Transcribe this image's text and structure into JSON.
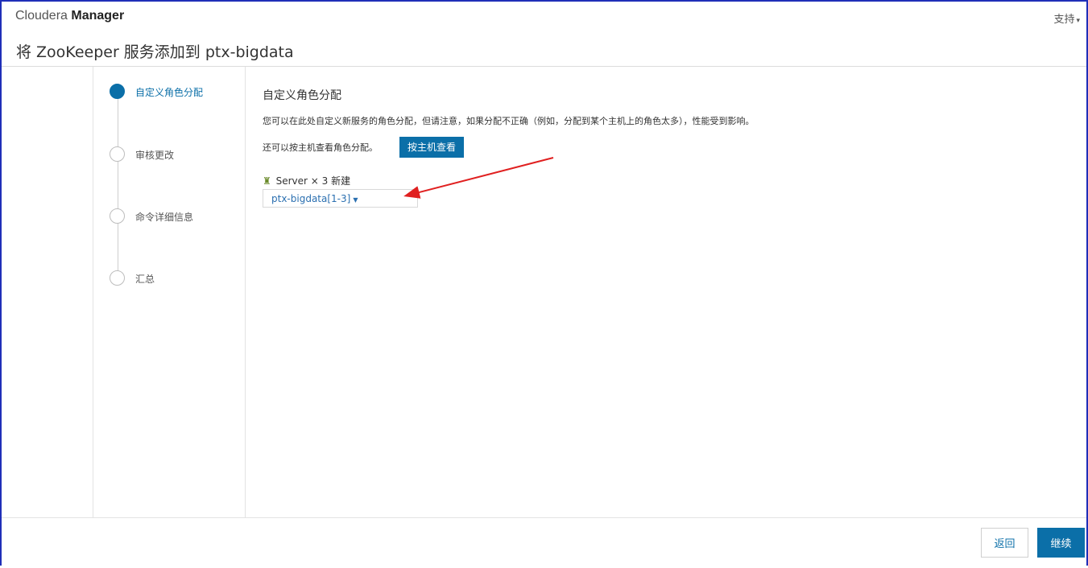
{
  "app": {
    "brand_light": "Cloudera ",
    "brand_bold": "Manager",
    "support_label": "支持"
  },
  "page": {
    "title": "将 ZooKeeper 服务添加到 ptx-bigdata"
  },
  "steps": [
    {
      "label": "自定义角色分配",
      "active": true
    },
    {
      "label": "审核更改",
      "active": false
    },
    {
      "label": "命令详细信息",
      "active": false
    },
    {
      "label": "汇总",
      "active": false
    }
  ],
  "main": {
    "section_title": "自定义角色分配",
    "description": "您可以在此处自定义新服务的角色分配，但请注意，如果分配不正确（例如，分配到某个主机上的角色太多），性能受到影响。",
    "by_host_text": "还可以按主机查看角色分配。",
    "by_host_button": "按主机查看",
    "role": {
      "name": "Server",
      "times": "×",
      "count": "3",
      "status": "新建"
    },
    "host_selection": "ptx-bigdata[1-3]"
  },
  "footer": {
    "back_label": "返回",
    "continue_label": "继续"
  },
  "colors": {
    "accent": "#0b6fa8",
    "annotation_arrow": "#e02020"
  }
}
